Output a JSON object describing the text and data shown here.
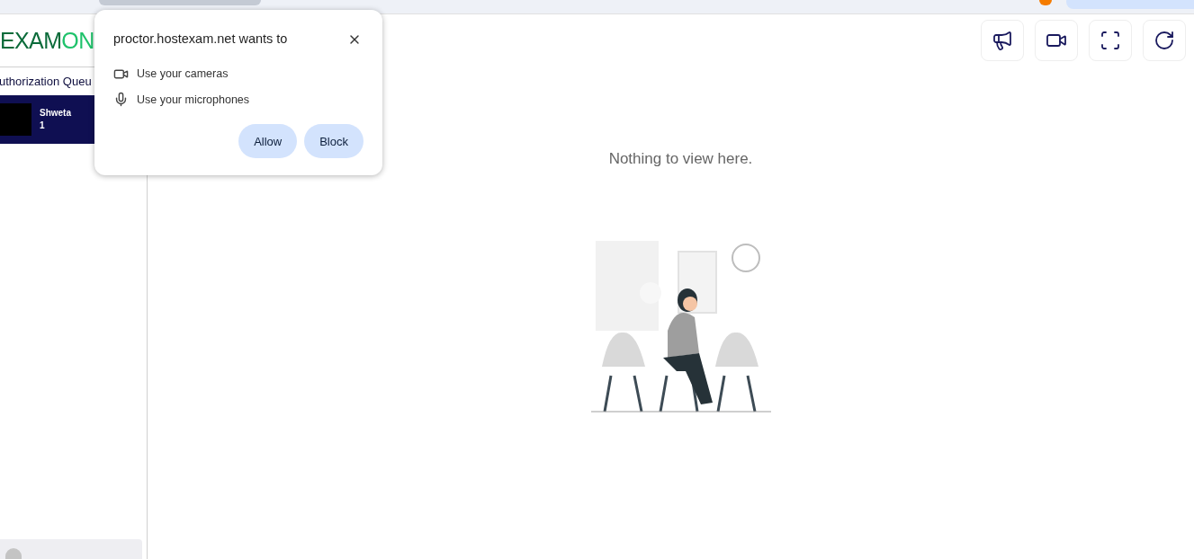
{
  "logo": {
    "dark": "EXAM",
    "light": "ON"
  },
  "sidebar": {
    "title": "uthorization Queu",
    "queue": [
      {
        "name": "Shweta",
        "count": "1"
      }
    ]
  },
  "toolbar": [
    {
      "kind": "announce"
    },
    {
      "kind": "camera"
    },
    {
      "kind": "fullscreen"
    },
    {
      "kind": "refresh"
    }
  ],
  "empty_state": {
    "message": "Nothing to view here."
  },
  "permission_popup": {
    "title": "proctor.hostexam.net wants to",
    "permissions": [
      {
        "kind": "camera",
        "label": "Use your cameras"
      },
      {
        "kind": "microphone",
        "label": "Use your microphones"
      }
    ],
    "buttons": [
      "Allow",
      "Block"
    ]
  }
}
